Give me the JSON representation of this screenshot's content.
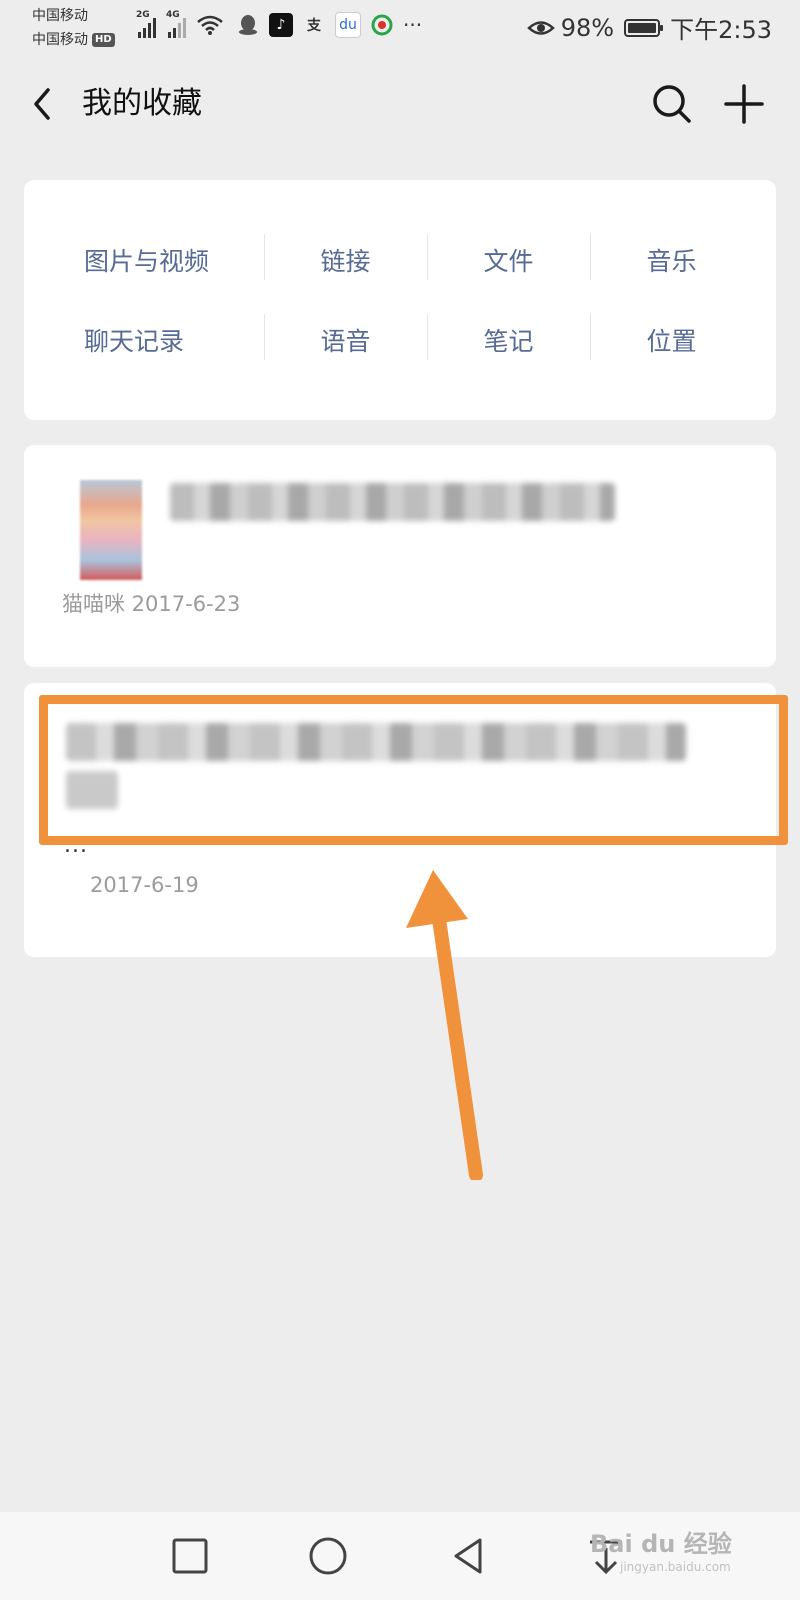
{
  "status_bar": {
    "carrier_1": "中国移动",
    "carrier_2": "中国移动",
    "hd_badge": "HD",
    "signal_1_gen": "2G",
    "signal_2_gen": "4G",
    "battery_percent": "98%",
    "battery_level": 0.98,
    "time": "下午2:53",
    "app_icons": [
      "qq-icon",
      "tiktok-icon",
      "alipay-icon",
      "baidu-icon",
      "browser-icon"
    ],
    "more": "···"
  },
  "header": {
    "title": "我的收藏"
  },
  "categories": {
    "row1": [
      "图片与视频",
      "链接",
      "文件",
      "音乐"
    ],
    "row2": [
      "聊天记录",
      "语音",
      "笔记",
      "位置"
    ]
  },
  "items": [
    {
      "meta": "猫喵咪 2017-6-23"
    },
    {
      "ellipsis": "...",
      "meta": "2017-6-19"
    }
  ],
  "watermark": {
    "text": "Bai du 经验",
    "sub": "jingyan.baidu.com"
  },
  "colors": {
    "accent_link": "#576b95",
    "highlight": "#f0913b",
    "background": "#ededed"
  }
}
